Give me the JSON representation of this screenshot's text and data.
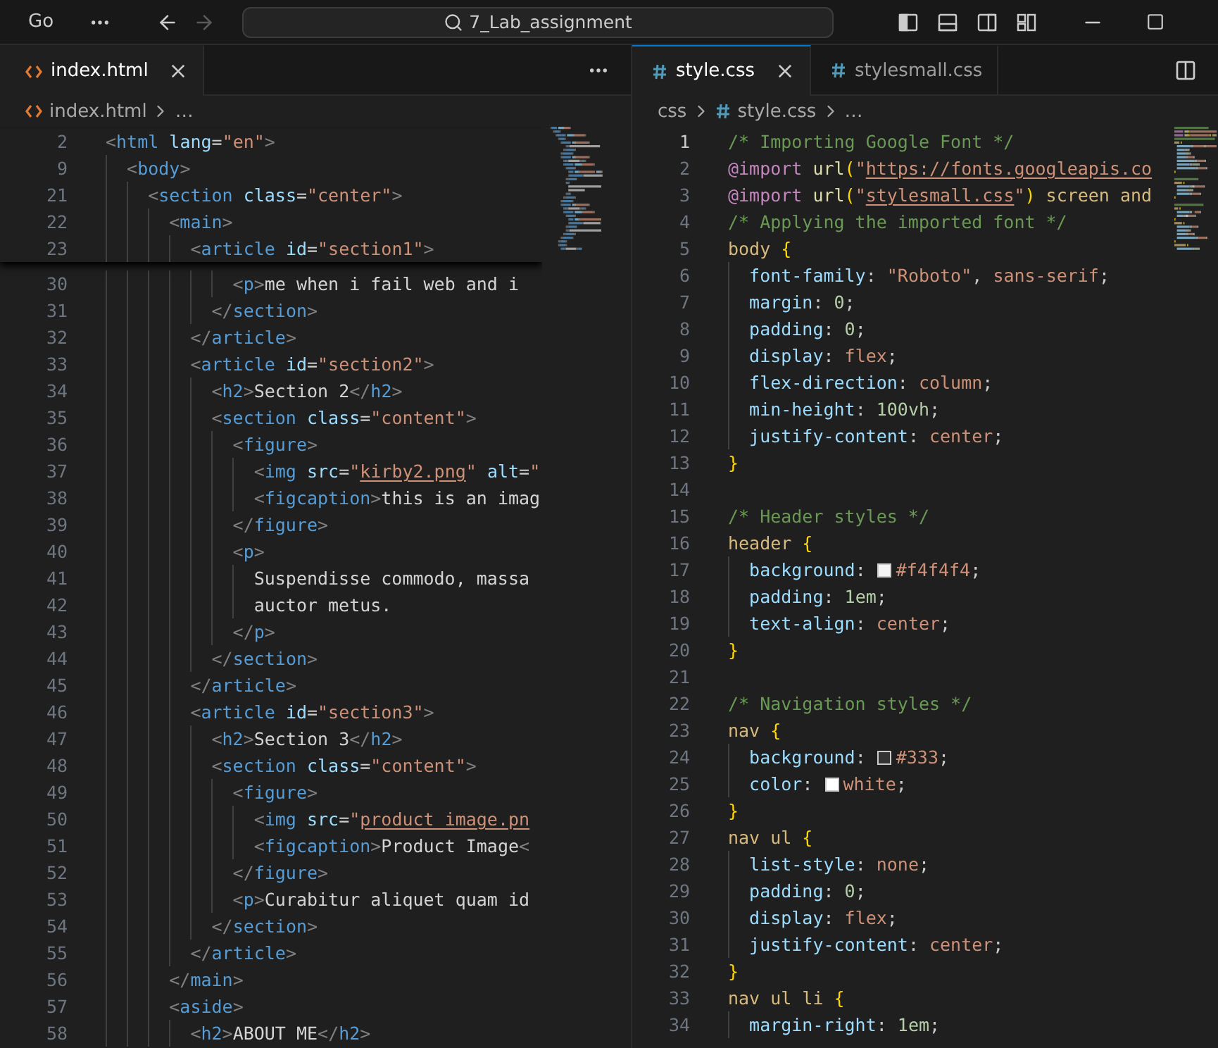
{
  "title_bar": {
    "menu_label": "Go",
    "nav": [
      {
        "kind": "back",
        "disabled": false
      },
      {
        "kind": "forward",
        "disabled": true
      }
    ],
    "search": {
      "value": "7_Lab_assignment"
    },
    "layout_toggles": [
      {
        "kind": "sidebar",
        "on": true
      },
      {
        "kind": "panel",
        "on": false
      },
      {
        "kind": "secondary",
        "on": false
      },
      {
        "kind": "customize",
        "on": false
      }
    ]
  },
  "editor_groups": [
    {
      "focused": false,
      "tabs": [
        {
          "label": "index.html",
          "kind": "html",
          "selected": true
        }
      ],
      "actions": [
        {
          "kind": "more"
        }
      ],
      "breadcrumbs": [
        {
          "kind": "html-file",
          "label": "index.html"
        },
        {
          "kind": "more",
          "label": "…"
        }
      ],
      "sticky_lines": [
        {
          "n": "2",
          "tokens": [
            {
              "text": "<",
              "kind": "punct"
            },
            {
              "text": "html",
              "kind": "tag"
            },
            {
              "text": " lang",
              "kind": "attr"
            },
            {
              "text": "=",
              "kind": "plain"
            },
            {
              "text": "\"en\"",
              "kind": "str"
            },
            {
              "text": ">",
              "kind": "punct"
            }
          ]
        },
        {
          "n": "9",
          "tokens": [
            {
              "text": "  <",
              "kind": "punct"
            },
            {
              "text": "body",
              "kind": "tag"
            },
            {
              "text": ">",
              "kind": "punct"
            }
          ]
        },
        {
          "n": "21",
          "tokens": [
            {
              "text": "    <",
              "kind": "punct"
            },
            {
              "text": "section",
              "kind": "tag"
            },
            {
              "text": " class",
              "kind": "attr"
            },
            {
              "text": "=",
              "kind": "plain"
            },
            {
              "text": "\"center\"",
              "kind": "str"
            },
            {
              "text": ">",
              "kind": "punct"
            }
          ]
        },
        {
          "n": "22",
          "tokens": [
            {
              "text": "      <",
              "kind": "punct"
            },
            {
              "text": "main",
              "kind": "tag"
            },
            {
              "text": ">",
              "kind": "punct"
            }
          ]
        },
        {
          "n": "23",
          "tokens": [
            {
              "text": "        <",
              "kind": "punct"
            },
            {
              "text": "article",
              "kind": "tag"
            },
            {
              "text": " id",
              "kind": "attr"
            },
            {
              "text": "=",
              "kind": "plain"
            },
            {
              "text": "\"section1\"",
              "kind": "str"
            },
            {
              "text": ">",
              "kind": "punct"
            }
          ]
        }
      ],
      "lines": [
        {
          "n": "30",
          "tokens": [
            {
              "text": "            <",
              "kind": "punct"
            },
            {
              "text": "p",
              "kind": "tag"
            },
            {
              "text": ">",
              "kind": "punct"
            },
            {
              "text": "me when i fail web and i",
              "kind": "text"
            }
          ]
        },
        {
          "n": "31",
          "tokens": [
            {
              "text": "          </",
              "kind": "punct"
            },
            {
              "text": "section",
              "kind": "tag"
            },
            {
              "text": ">",
              "kind": "punct"
            }
          ]
        },
        {
          "n": "32",
          "tokens": [
            {
              "text": "        </",
              "kind": "punct"
            },
            {
              "text": "article",
              "kind": "tag"
            },
            {
              "text": ">",
              "kind": "punct"
            }
          ]
        },
        {
          "n": "33",
          "tokens": [
            {
              "text": "        <",
              "kind": "punct"
            },
            {
              "text": "article",
              "kind": "tag"
            },
            {
              "text": " id",
              "kind": "attr"
            },
            {
              "text": "=",
              "kind": "plain"
            },
            {
              "text": "\"section2\"",
              "kind": "str"
            },
            {
              "text": ">",
              "kind": "punct"
            }
          ]
        },
        {
          "n": "34",
          "tokens": [
            {
              "text": "          <",
              "kind": "punct"
            },
            {
              "text": "h2",
              "kind": "tag"
            },
            {
              "text": ">",
              "kind": "punct"
            },
            {
              "text": "Section 2",
              "kind": "text"
            },
            {
              "text": "</",
              "kind": "punct"
            },
            {
              "text": "h2",
              "kind": "tag"
            },
            {
              "text": ">",
              "kind": "punct"
            }
          ]
        },
        {
          "n": "35",
          "tokens": [
            {
              "text": "          <",
              "kind": "punct"
            },
            {
              "text": "section",
              "kind": "tag"
            },
            {
              "text": " class",
              "kind": "attr"
            },
            {
              "text": "=",
              "kind": "plain"
            },
            {
              "text": "\"content\"",
              "kind": "str"
            },
            {
              "text": ">",
              "kind": "punct"
            }
          ]
        },
        {
          "n": "36",
          "tokens": [
            {
              "text": "            <",
              "kind": "punct"
            },
            {
              "text": "figure",
              "kind": "tag"
            },
            {
              "text": ">",
              "kind": "punct"
            }
          ]
        },
        {
          "n": "37",
          "tokens": [
            {
              "text": "              <",
              "kind": "punct"
            },
            {
              "text": "img",
              "kind": "tag"
            },
            {
              "text": " src",
              "kind": "attr"
            },
            {
              "text": "=",
              "kind": "plain"
            },
            {
              "text": "\"",
              "kind": "str"
            },
            {
              "text": "kirby2.png",
              "kind": "link"
            },
            {
              "text": "\"",
              "kind": "str"
            },
            {
              "text": " alt",
              "kind": "attr"
            },
            {
              "text": "=",
              "kind": "plain"
            },
            {
              "text": "\"",
              "kind": "str"
            }
          ]
        },
        {
          "n": "38",
          "tokens": [
            {
              "text": "              <",
              "kind": "punct"
            },
            {
              "text": "figcaption",
              "kind": "tag"
            },
            {
              "text": ">",
              "kind": "punct"
            },
            {
              "text": "this is an imag",
              "kind": "text"
            }
          ]
        },
        {
          "n": "39",
          "tokens": [
            {
              "text": "            </",
              "kind": "punct"
            },
            {
              "text": "figure",
              "kind": "tag"
            },
            {
              "text": ">",
              "kind": "punct"
            }
          ]
        },
        {
          "n": "40",
          "tokens": [
            {
              "text": "            <",
              "kind": "punct"
            },
            {
              "text": "p",
              "kind": "tag"
            },
            {
              "text": ">",
              "kind": "punct"
            }
          ]
        },
        {
          "n": "41",
          "tokens": [
            {
              "text": "              Suspendisse commodo, massa",
              "kind": "text"
            }
          ]
        },
        {
          "n": "42",
          "tokens": [
            {
              "text": "              auctor metus.",
              "kind": "text"
            }
          ]
        },
        {
          "n": "43",
          "tokens": [
            {
              "text": "            </",
              "kind": "punct"
            },
            {
              "text": "p",
              "kind": "tag"
            },
            {
              "text": ">",
              "kind": "punct"
            }
          ]
        },
        {
          "n": "44",
          "tokens": [
            {
              "text": "          </",
              "kind": "punct"
            },
            {
              "text": "section",
              "kind": "tag"
            },
            {
              "text": ">",
              "kind": "punct"
            }
          ]
        },
        {
          "n": "45",
          "tokens": [
            {
              "text": "        </",
              "kind": "punct"
            },
            {
              "text": "article",
              "kind": "tag"
            },
            {
              "text": ">",
              "kind": "punct"
            }
          ]
        },
        {
          "n": "46",
          "tokens": [
            {
              "text": "        <",
              "kind": "punct"
            },
            {
              "text": "article",
              "kind": "tag"
            },
            {
              "text": " id",
              "kind": "attr"
            },
            {
              "text": "=",
              "kind": "plain"
            },
            {
              "text": "\"section3\"",
              "kind": "str"
            },
            {
              "text": ">",
              "kind": "punct"
            }
          ]
        },
        {
          "n": "47",
          "tokens": [
            {
              "text": "          <",
              "kind": "punct"
            },
            {
              "text": "h2",
              "kind": "tag"
            },
            {
              "text": ">",
              "kind": "punct"
            },
            {
              "text": "Section 3",
              "kind": "text"
            },
            {
              "text": "</",
              "kind": "punct"
            },
            {
              "text": "h2",
              "kind": "tag"
            },
            {
              "text": ">",
              "kind": "punct"
            }
          ]
        },
        {
          "n": "48",
          "tokens": [
            {
              "text": "          <",
              "kind": "punct"
            },
            {
              "text": "section",
              "kind": "tag"
            },
            {
              "text": " class",
              "kind": "attr"
            },
            {
              "text": "=",
              "kind": "plain"
            },
            {
              "text": "\"content\"",
              "kind": "str"
            },
            {
              "text": ">",
              "kind": "punct"
            }
          ]
        },
        {
          "n": "49",
          "tokens": [
            {
              "text": "            <",
              "kind": "punct"
            },
            {
              "text": "figure",
              "kind": "tag"
            },
            {
              "text": ">",
              "kind": "punct"
            }
          ]
        },
        {
          "n": "50",
          "tokens": [
            {
              "text": "              <",
              "kind": "punct"
            },
            {
              "text": "img",
              "kind": "tag"
            },
            {
              "text": " src",
              "kind": "attr"
            },
            {
              "text": "=",
              "kind": "plain"
            },
            {
              "text": "\"",
              "kind": "str"
            },
            {
              "text": "product image.pn",
              "kind": "link"
            }
          ]
        },
        {
          "n": "51",
          "tokens": [
            {
              "text": "              <",
              "kind": "punct"
            },
            {
              "text": "figcaption",
              "kind": "tag"
            },
            {
              "text": ">",
              "kind": "punct"
            },
            {
              "text": "Product Image",
              "kind": "text"
            },
            {
              "text": "<",
              "kind": "punct"
            }
          ]
        },
        {
          "n": "52",
          "tokens": [
            {
              "text": "            </",
              "kind": "punct"
            },
            {
              "text": "figure",
              "kind": "tag"
            },
            {
              "text": ">",
              "kind": "punct"
            }
          ]
        },
        {
          "n": "53",
          "tokens": [
            {
              "text": "            <",
              "kind": "punct"
            },
            {
              "text": "p",
              "kind": "tag"
            },
            {
              "text": ">",
              "kind": "punct"
            },
            {
              "text": "Curabitur aliquet quam id",
              "kind": "text"
            }
          ]
        },
        {
          "n": "54",
          "tokens": [
            {
              "text": "          </",
              "kind": "punct"
            },
            {
              "text": "section",
              "kind": "tag"
            },
            {
              "text": ">",
              "kind": "punct"
            }
          ]
        },
        {
          "n": "55",
          "tokens": [
            {
              "text": "        </",
              "kind": "punct"
            },
            {
              "text": "article",
              "kind": "tag"
            },
            {
              "text": ">",
              "kind": "punct"
            }
          ]
        },
        {
          "n": "56",
          "tokens": [
            {
              "text": "      </",
              "kind": "punct"
            },
            {
              "text": "main",
              "kind": "tag"
            },
            {
              "text": ">",
              "kind": "punct"
            }
          ]
        },
        {
          "n": "57",
          "tokens": [
            {
              "text": "      <",
              "kind": "punct"
            },
            {
              "text": "aside",
              "kind": "tag"
            },
            {
              "text": ">",
              "kind": "punct"
            }
          ]
        },
        {
          "n": "58",
          "tokens": [
            {
              "text": "        <",
              "kind": "punct"
            },
            {
              "text": "h2",
              "kind": "tag"
            },
            {
              "text": ">",
              "kind": "punct"
            },
            {
              "text": "ABOUT ME",
              "kind": "text"
            },
            {
              "text": "</",
              "kind": "punct"
            },
            {
              "text": "h2",
              "kind": "tag"
            },
            {
              "text": ">",
              "kind": "punct"
            }
          ]
        }
      ]
    },
    {
      "focused": true,
      "tabs": [
        {
          "label": "style.css",
          "kind": "css",
          "selected": true
        },
        {
          "label": "stylesmall.css",
          "kind": "css",
          "selected": false
        }
      ],
      "actions": [
        {
          "kind": "split"
        }
      ],
      "breadcrumbs": [
        {
          "kind": "folder",
          "label": "css"
        },
        {
          "kind": "css-file",
          "label": "style.css"
        },
        {
          "kind": "more",
          "label": "…"
        }
      ],
      "lines": [
        {
          "n": "1",
          "active": true,
          "tokens": [
            {
              "text": "/* Importing Google Font */",
              "kind": "comment"
            }
          ]
        },
        {
          "n": "2",
          "active": false,
          "tokens": [
            {
              "text": "@import",
              "kind": "atrule"
            },
            {
              "text": " url",
              "kind": "fn"
            },
            {
              "text": "(",
              "kind": "paren"
            },
            {
              "text": "\"",
              "kind": "str"
            },
            {
              "text": "https://fonts.googleapis.co",
              "kind": "link"
            }
          ]
        },
        {
          "n": "3",
          "active": false,
          "tokens": [
            {
              "text": "@import",
              "kind": "atrule"
            },
            {
              "text": " url",
              "kind": "fn"
            },
            {
              "text": "(",
              "kind": "paren"
            },
            {
              "text": "\"",
              "kind": "str"
            },
            {
              "text": "stylesmall.css",
              "kind": "link"
            },
            {
              "text": "\"",
              "kind": "str"
            },
            {
              "text": ")",
              "kind": "paren"
            },
            {
              "text": " screen and",
              "kind": "sel"
            }
          ]
        },
        {
          "n": "4",
          "active": false,
          "tokens": [
            {
              "text": "/* Applying the imported font */",
              "kind": "comment"
            }
          ]
        },
        {
          "n": "5",
          "active": false,
          "tokens": [
            {
              "text": "body",
              "kind": "sel"
            },
            {
              "text": " {",
              "kind": "brace"
            }
          ]
        },
        {
          "n": "6",
          "active": false,
          "tokens": [
            {
              "text": "  font-family",
              "kind": "prop"
            },
            {
              "text": ": ",
              "kind": "plain"
            },
            {
              "text": "\"Roboto\"",
              "kind": "str"
            },
            {
              "text": ", ",
              "kind": "plain"
            },
            {
              "text": "sans-serif",
              "kind": "value"
            },
            {
              "text": ";",
              "kind": "plain"
            }
          ]
        },
        {
          "n": "7",
          "active": false,
          "tokens": [
            {
              "text": "  margin",
              "kind": "prop"
            },
            {
              "text": ": ",
              "kind": "plain"
            },
            {
              "text": "0",
              "kind": "num"
            },
            {
              "text": ";",
              "kind": "plain"
            }
          ]
        },
        {
          "n": "8",
          "active": false,
          "tokens": [
            {
              "text": "  padding",
              "kind": "prop"
            },
            {
              "text": ": ",
              "kind": "plain"
            },
            {
              "text": "0",
              "kind": "num"
            },
            {
              "text": ";",
              "kind": "plain"
            }
          ]
        },
        {
          "n": "9",
          "active": false,
          "tokens": [
            {
              "text": "  display",
              "kind": "prop"
            },
            {
              "text": ": ",
              "kind": "plain"
            },
            {
              "text": "flex",
              "kind": "value"
            },
            {
              "text": ";",
              "kind": "plain"
            }
          ]
        },
        {
          "n": "10",
          "active": false,
          "tokens": [
            {
              "text": "  flex-direction",
              "kind": "prop"
            },
            {
              "text": ": ",
              "kind": "plain"
            },
            {
              "text": "column",
              "kind": "value"
            },
            {
              "text": ";",
              "kind": "plain"
            }
          ]
        },
        {
          "n": "11",
          "active": false,
          "tokens": [
            {
              "text": "  min-height",
              "kind": "prop"
            },
            {
              "text": ": ",
              "kind": "plain"
            },
            {
              "text": "100vh",
              "kind": "num"
            },
            {
              "text": ";",
              "kind": "plain"
            }
          ]
        },
        {
          "n": "12",
          "active": false,
          "tokens": [
            {
              "text": "  justify-content",
              "kind": "prop"
            },
            {
              "text": ": ",
              "kind": "plain"
            },
            {
              "text": "center",
              "kind": "value"
            },
            {
              "text": ";",
              "kind": "plain"
            }
          ]
        },
        {
          "n": "13",
          "active": false,
          "tokens": [
            {
              "text": "}",
              "kind": "brace"
            }
          ]
        },
        {
          "n": "14",
          "active": false
        },
        {
          "n": "15",
          "active": false,
          "tokens": [
            {
              "text": "/* Header styles */",
              "kind": "comment"
            }
          ]
        },
        {
          "n": "16",
          "active": false,
          "tokens": [
            {
              "text": "header",
              "kind": "sel"
            },
            {
              "text": " {",
              "kind": "brace"
            }
          ]
        },
        {
          "n": "17",
          "active": false,
          "tokens": [
            {
              "text": "  background",
              "kind": "prop"
            },
            {
              "text": ": ",
              "kind": "plain"
            },
            {
              "kind": "swatch",
              "color": "#f4f4f4"
            },
            {
              "text": "#f4f4f4",
              "kind": "value"
            },
            {
              "text": ";",
              "kind": "plain"
            }
          ]
        },
        {
          "n": "18",
          "active": false,
          "tokens": [
            {
              "text": "  padding",
              "kind": "prop"
            },
            {
              "text": ": ",
              "kind": "plain"
            },
            {
              "text": "1em",
              "kind": "num"
            },
            {
              "text": ";",
              "kind": "plain"
            }
          ]
        },
        {
          "n": "19",
          "active": false,
          "tokens": [
            {
              "text": "  text-align",
              "kind": "prop"
            },
            {
              "text": ": ",
              "kind": "plain"
            },
            {
              "text": "center",
              "kind": "value"
            },
            {
              "text": ";",
              "kind": "plain"
            }
          ]
        },
        {
          "n": "20",
          "active": false,
          "tokens": [
            {
              "text": "}",
              "kind": "brace"
            }
          ]
        },
        {
          "n": "21",
          "active": false
        },
        {
          "n": "22",
          "active": false,
          "tokens": [
            {
              "text": "/* Navigation styles */",
              "kind": "comment"
            }
          ]
        },
        {
          "n": "23",
          "active": false,
          "tokens": [
            {
              "text": "nav",
              "kind": "sel"
            },
            {
              "text": " {",
              "kind": "brace"
            }
          ]
        },
        {
          "n": "24",
          "active": false,
          "tokens": [
            {
              "text": "  background",
              "kind": "prop"
            },
            {
              "text": ": ",
              "kind": "plain"
            },
            {
              "kind": "swatch",
              "color": "#333333"
            },
            {
              "text": "#333",
              "kind": "value"
            },
            {
              "text": ";",
              "kind": "plain"
            }
          ]
        },
        {
          "n": "25",
          "active": false,
          "tokens": [
            {
              "text": "  color",
              "kind": "prop"
            },
            {
              "text": ": ",
              "kind": "plain"
            },
            {
              "kind": "swatch",
              "color": "#ffffff"
            },
            {
              "text": "white",
              "kind": "value"
            },
            {
              "text": ";",
              "kind": "plain"
            }
          ]
        },
        {
          "n": "26",
          "active": false,
          "tokens": [
            {
              "text": "}",
              "kind": "brace"
            }
          ]
        },
        {
          "n": "27",
          "active": false,
          "tokens": [
            {
              "text": "nav ul",
              "kind": "sel"
            },
            {
              "text": " {",
              "kind": "brace"
            }
          ]
        },
        {
          "n": "28",
          "active": false,
          "tokens": [
            {
              "text": "  list-style",
              "kind": "prop"
            },
            {
              "text": ": ",
              "kind": "plain"
            },
            {
              "text": "none",
              "kind": "value"
            },
            {
              "text": ";",
              "kind": "plain"
            }
          ]
        },
        {
          "n": "29",
          "active": false,
          "tokens": [
            {
              "text": "  padding",
              "kind": "prop"
            },
            {
              "text": ": ",
              "kind": "plain"
            },
            {
              "text": "0",
              "kind": "num"
            },
            {
              "text": ";",
              "kind": "plain"
            }
          ]
        },
        {
          "n": "30",
          "active": false,
          "tokens": [
            {
              "text": "  display",
              "kind": "prop"
            },
            {
              "text": ": ",
              "kind": "plain"
            },
            {
              "text": "flex",
              "kind": "value"
            },
            {
              "text": ";",
              "kind": "plain"
            }
          ]
        },
        {
          "n": "31",
          "active": false,
          "tokens": [
            {
              "text": "  justify-content",
              "kind": "prop"
            },
            {
              "text": ": ",
              "kind": "plain"
            },
            {
              "text": "center",
              "kind": "value"
            },
            {
              "text": ";",
              "kind": "plain"
            }
          ]
        },
        {
          "n": "32",
          "active": false,
          "tokens": [
            {
              "text": "}",
              "kind": "brace"
            }
          ]
        },
        {
          "n": "33",
          "active": false,
          "tokens": [
            {
              "text": "nav ul li",
              "kind": "sel"
            },
            {
              "text": " {",
              "kind": "brace"
            }
          ]
        },
        {
          "n": "34",
          "active": false,
          "tokens": [
            {
              "text": "  margin-right",
              "kind": "prop"
            },
            {
              "text": ": ",
              "kind": "plain"
            },
            {
              "text": "1em",
              "kind": "num"
            },
            {
              "text": ";",
              "kind": "plain"
            }
          ]
        }
      ]
    }
  ]
}
